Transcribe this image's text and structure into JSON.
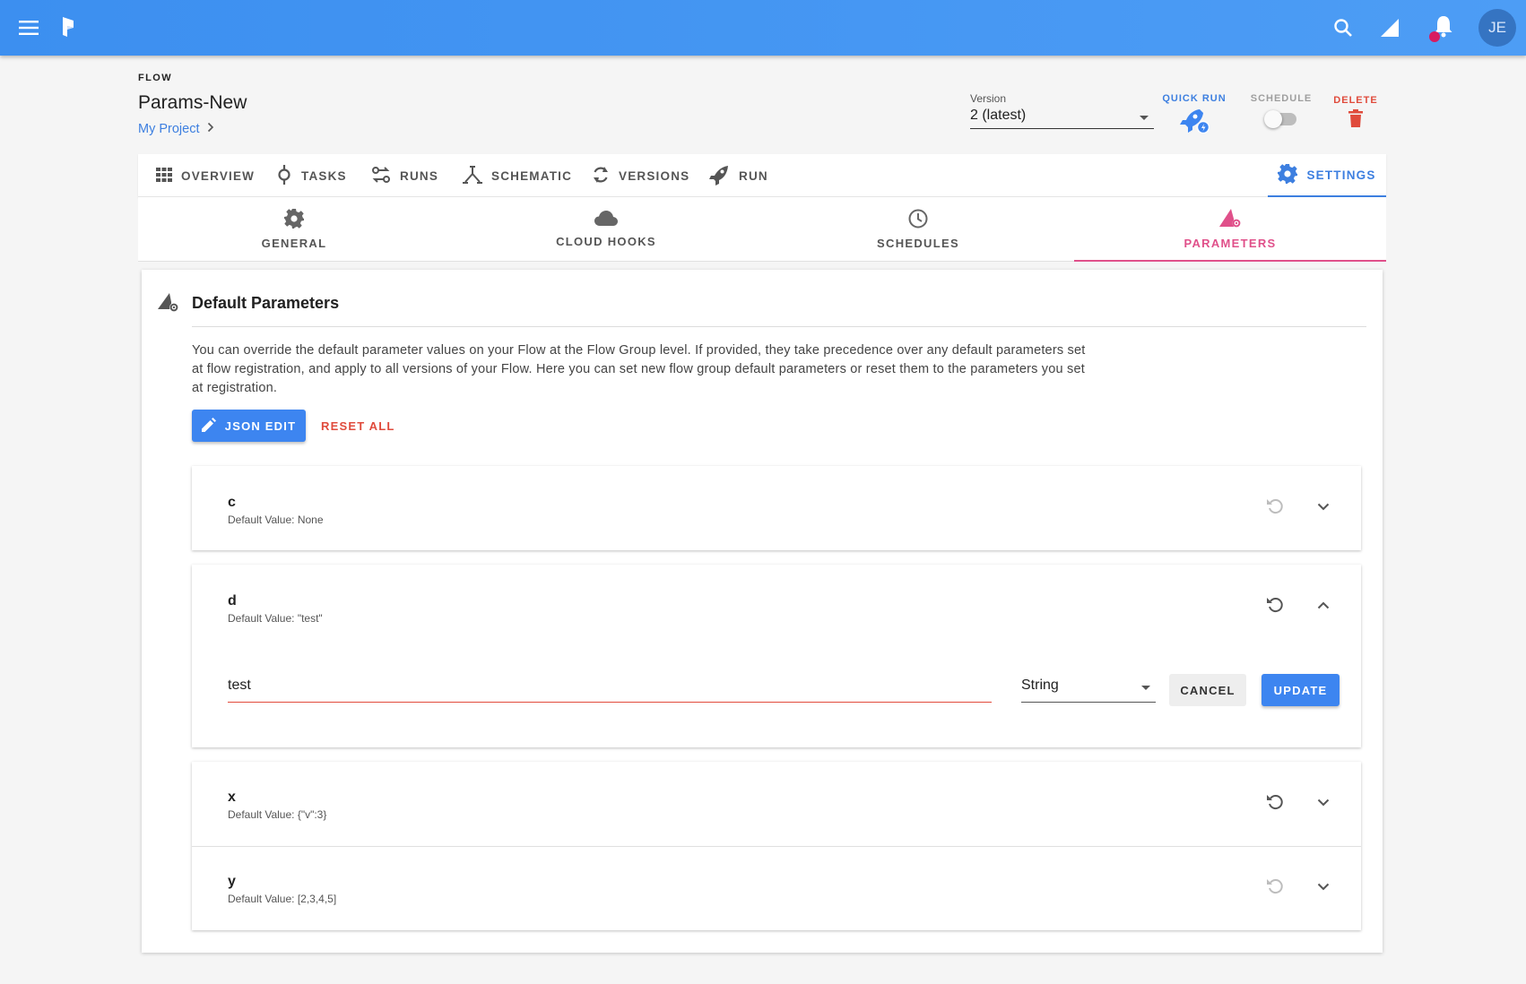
{
  "topbar": {
    "avatar_initials": "JE",
    "icons": [
      "menu-icon",
      "prefect-logo",
      "search-icon",
      "signal-icon",
      "bell-icon"
    ],
    "colors": {
      "bar": "#3c8ff0",
      "notification": "#d81b60"
    }
  },
  "header": {
    "kicker": "FLOW",
    "title": "Params-New",
    "project": "My Project",
    "version_label": "Version",
    "version_value": "2 (latest)",
    "quick_run_label": "QUICK RUN",
    "schedule_label": "SCHEDULE",
    "schedule_on": false,
    "delete_label": "DELETE"
  },
  "main_tabs": [
    {
      "label": "OVERVIEW",
      "icon": "grid-icon"
    },
    {
      "label": "TASKS",
      "icon": "task-icon"
    },
    {
      "label": "RUNS",
      "icon": "runs-icon"
    },
    {
      "label": "SCHEMATIC",
      "icon": "schematic-icon"
    },
    {
      "label": "VERSIONS",
      "icon": "versions-icon"
    },
    {
      "label": "RUN",
      "icon": "rocket-icon"
    },
    {
      "label": "SETTINGS",
      "icon": "gear-icon",
      "active": true
    }
  ],
  "sub_tabs": [
    {
      "label": "GENERAL",
      "icon": "gear-icon"
    },
    {
      "label": "CLOUD HOOKS",
      "icon": "cloud-icon"
    },
    {
      "label": "SCHEDULES",
      "icon": "clock-icon"
    },
    {
      "label": "PARAMETERS",
      "icon": "parameters-icon",
      "active": true
    }
  ],
  "card": {
    "title": "Default Parameters",
    "description": "You can override the default parameter values on your Flow at the Flow Group level. If provided, they take precedence over any default parameters set at flow registration, and apply to all versions of your Flow. Here you can set new flow group default parameters or reset them to the parameters you set at registration.",
    "json_edit_label": "JSON EDIT",
    "reset_all_label": "RESET ALL"
  },
  "parameters": [
    {
      "name": "c",
      "default": "Default Value: None",
      "expanded": false
    },
    {
      "name": "d",
      "default": "Default Value: \"test\"",
      "expanded": true,
      "input_value": "test",
      "type": "String",
      "cancel_label": "CANCEL",
      "update_label": "UPDATE"
    },
    {
      "name": "x",
      "default": "Default Value: {\"v\":3}",
      "expanded": false
    },
    {
      "name": "y",
      "default": "Default Value: [2,3,4,5]",
      "expanded": false
    }
  ]
}
